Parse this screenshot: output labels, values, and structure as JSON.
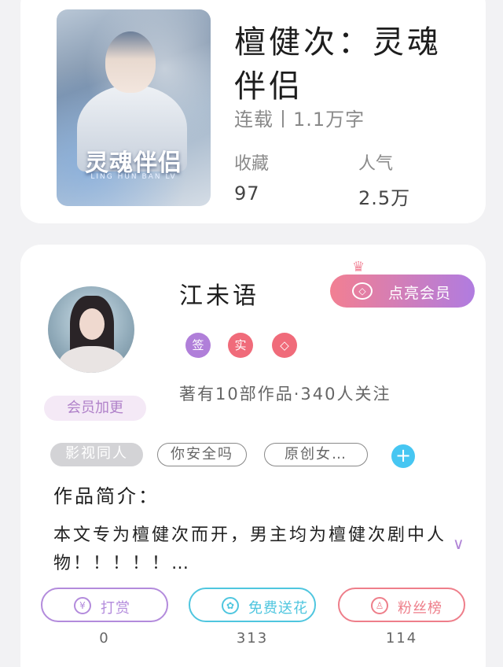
{
  "book": {
    "cover_title": "灵魂伴侣",
    "cover_subtitle": "LING HUN BAN LV",
    "title": "檀健次：灵魂伴侣",
    "meta": "连载丨1.1万字",
    "favorites_label": "收藏",
    "favorites_value": "97",
    "popularity_label": "人气",
    "popularity_value": "2.5万"
  },
  "author": {
    "name": "江未语",
    "member_badge": "会员加更",
    "vip_button_label": "点亮会员",
    "icons": [
      {
        "name": "sign-icon",
        "glyph": "签",
        "color": "#b07fd9"
      },
      {
        "name": "real-icon",
        "glyph": "实",
        "color": "#f06b7a"
      },
      {
        "name": "diamond-icon",
        "glyph": "◇",
        "color": "#f06b7a"
      }
    ],
    "stats": "著有10部作品·340人关注"
  },
  "tags": [
    "影视同人",
    "你安全吗",
    "原创女…"
  ],
  "intro": {
    "heading": "作品简介：",
    "text": "本文专为檀健次而开，男主均为檀健次剧中人物！！！！！…"
  },
  "actions": [
    {
      "label": "打赏",
      "count": "0",
      "color": "#b38bdc",
      "icon": "¥"
    },
    {
      "label": "免费送花",
      "count": "313",
      "color": "#4fc6df",
      "icon": "✿"
    },
    {
      "label": "粉丝榜",
      "count": "114",
      "color": "#ee7e8a",
      "icon": "♙"
    }
  ]
}
